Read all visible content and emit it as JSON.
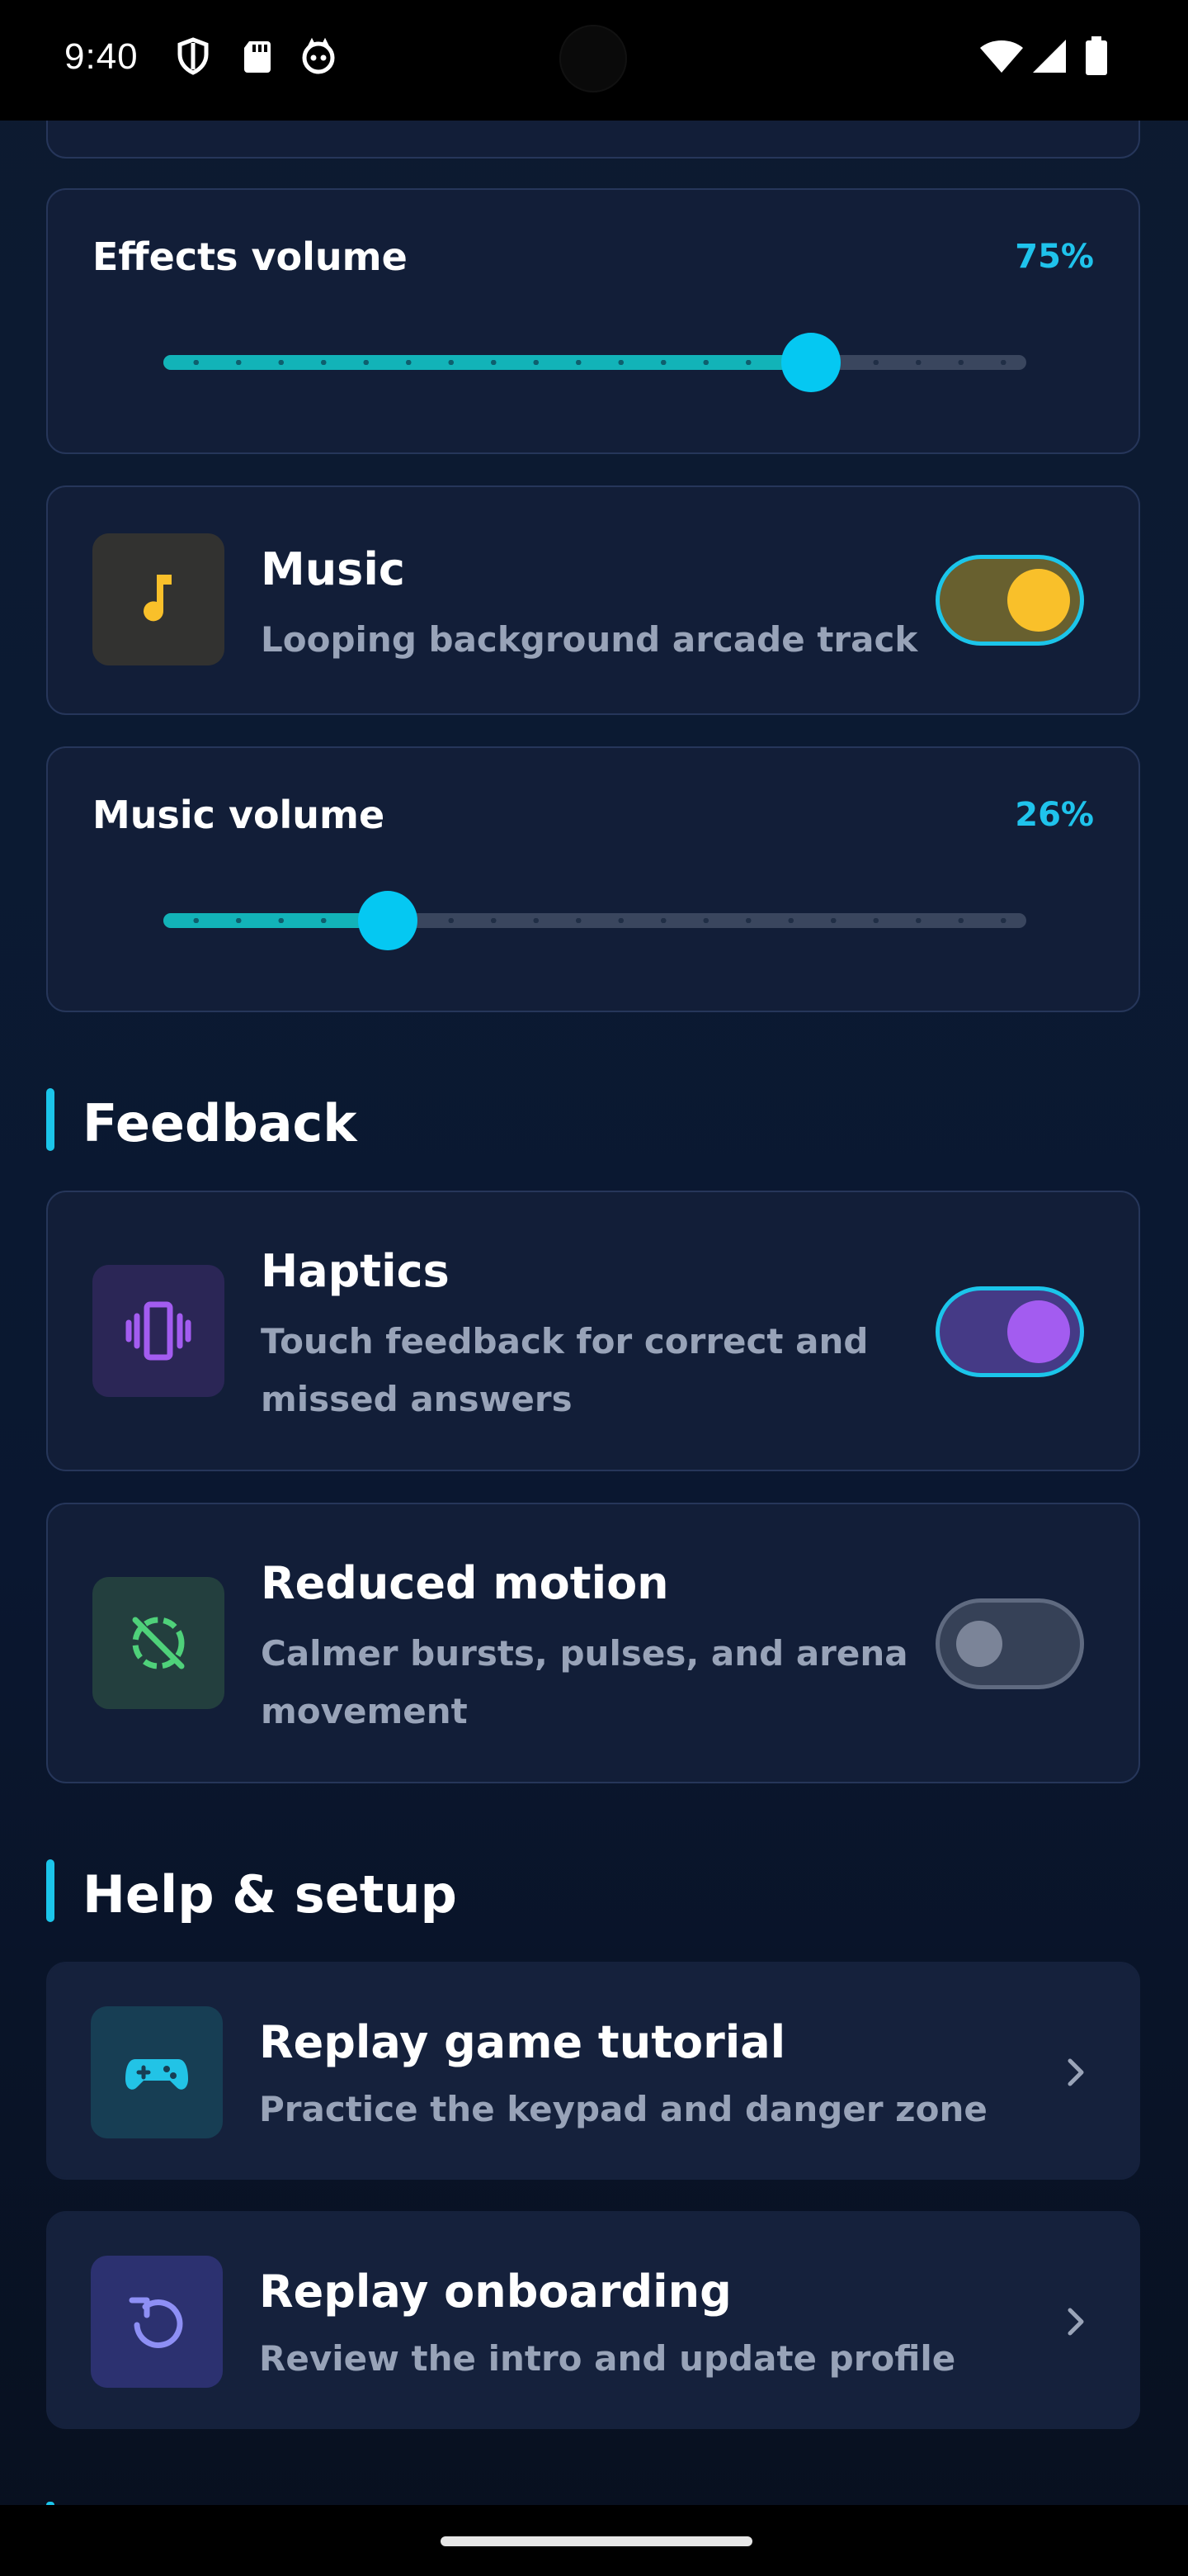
{
  "status_bar": {
    "time": "9:40",
    "left_icons": [
      "shield-icon",
      "sd-card-icon",
      "game-notification-icon"
    ],
    "right_icons": [
      "wifi-icon",
      "signal-icon",
      "battery-icon"
    ]
  },
  "effects_volume": {
    "label": "Effects volume",
    "value_text": "75%",
    "value": 0.75
  },
  "music": {
    "title": "Music",
    "subtitle": "Looping background arcade track",
    "enabled": true,
    "icon": "music-note-icon",
    "accent": "#f9c02a"
  },
  "music_volume": {
    "label": "Music volume",
    "value_text": "26%",
    "value": 0.26
  },
  "feedback": {
    "section_title": "Feedback",
    "haptics": {
      "title": "Haptics",
      "subtitle_line1": "Touch feedback for correct and",
      "subtitle_line2": "missed answers",
      "enabled": true,
      "icon": "vibration-icon",
      "accent": "#a35cf0"
    },
    "reduced_motion": {
      "title": "Reduced motion",
      "subtitle_line1": "Calmer bursts, pulses, and arena",
      "subtitle_line2": "movement",
      "enabled": false,
      "icon": "motion-off-icon",
      "accent": "#4fd17a"
    }
  },
  "help": {
    "section_title": "Help & setup",
    "tutorial": {
      "title": "Replay game tutorial",
      "subtitle": "Practice the keypad and danger zone",
      "icon": "gamepad-icon"
    },
    "onboarding": {
      "title": "Replay onboarding",
      "subtitle": "Review the intro and update profile",
      "icon": "replay-icon"
    }
  },
  "colors": {
    "accent_cyan": "#1bc5ea",
    "slider_fill": "#12b3b8",
    "card_bg": "#121e38"
  }
}
